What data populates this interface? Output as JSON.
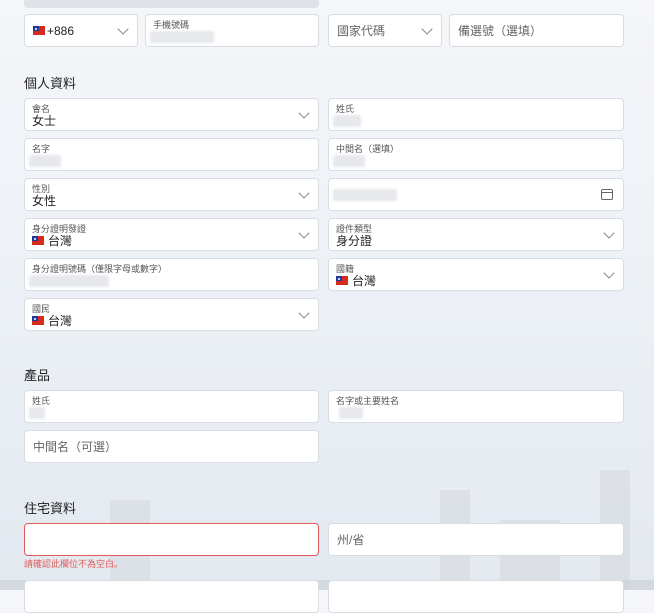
{
  "contact": {
    "country_code": "+886",
    "phone_label": "手機號碼",
    "country_code_placeholder": "國家代碼",
    "backup_phone_placeholder": "備選號（選填）"
  },
  "personal": {
    "section_title": "個人資料",
    "title_label": "會名",
    "title_value": "女士",
    "surname_label": "姓氏",
    "given_name_label": "名字",
    "middle_name_label": "中間名（選填）",
    "gender_label": "性別",
    "gender_value": "女性",
    "id_issuer_label": "身分證明發證",
    "id_issuer_value": "台灣",
    "doc_type_label": "證件類型",
    "doc_type_value": "身分證",
    "id_number_label": "身分證明號碼（僅限字母或數字）",
    "nationality_label": "國籍",
    "nationality_value": "台灣",
    "residence_label": "國民",
    "residence_value": "台灣"
  },
  "product": {
    "section_title": "產品",
    "surname_label": "姓氏",
    "given_name_label": "名字或主要姓名",
    "middle_name_placeholder": "中間名（可選）"
  },
  "address": {
    "section_title": "住宅資料",
    "state_placeholder": "州/省",
    "error_text": "請確認此欄位不為空白。"
  },
  "colors": {
    "error": "#e05a5a",
    "border": "#d8dde3",
    "flag_red": "#d52b1e",
    "flag_blue": "#1c3c9b"
  }
}
